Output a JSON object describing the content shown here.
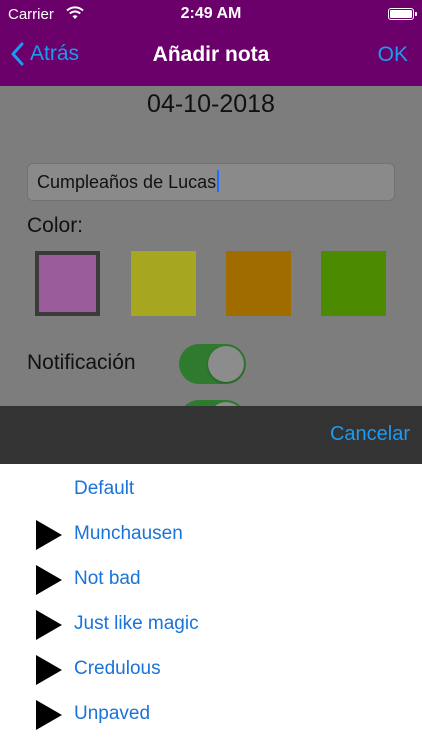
{
  "status": {
    "carrier": "Carrier",
    "time": "2:49 AM"
  },
  "nav": {
    "back_label": "Atrás",
    "title": "Añadir nota",
    "ok_label": "OK"
  },
  "form": {
    "date": "04-10-2018",
    "note_text": "Cumpleaños de Lucas",
    "color_label": "Color:",
    "colors": [
      "#9a5c9a",
      "#a6a61f",
      "#a06c00",
      "#4c8a00"
    ],
    "selected_color_index": 0,
    "notification_label": "Notificación",
    "notification_on": true
  },
  "picker": {
    "cancel_label": "Cancelar",
    "options": [
      {
        "label": "Default",
        "play_icon": false
      },
      {
        "label": "Munchausen",
        "play_icon": true
      },
      {
        "label": "Not bad",
        "play_icon": true
      },
      {
        "label": "Just like magic",
        "play_icon": true
      },
      {
        "label": "Credulous",
        "play_icon": true
      },
      {
        "label": "Unpaved",
        "play_icon": true
      }
    ]
  }
}
